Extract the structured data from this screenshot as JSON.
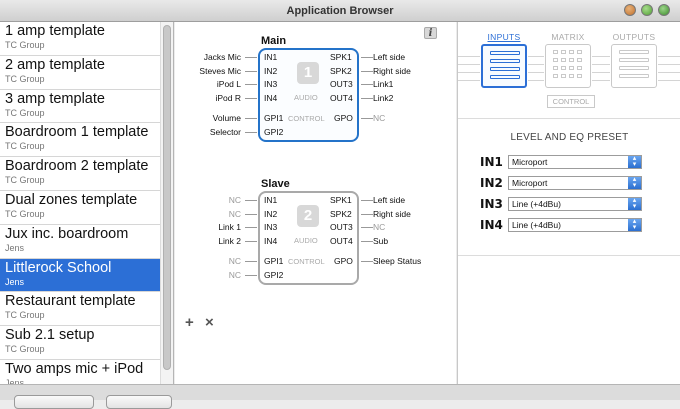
{
  "window": {
    "title": "Application Browser"
  },
  "templates": [
    {
      "name": "1 amp template",
      "author": "TC Group"
    },
    {
      "name": "2 amp template",
      "author": "TC Group"
    },
    {
      "name": "3 amp template",
      "author": "TC Group"
    },
    {
      "name": "Boardroom 1 template",
      "author": "TC Group"
    },
    {
      "name": "Boardroom 2 template",
      "author": "TC Group"
    },
    {
      "name": "Dual zones template",
      "author": "TC Group"
    },
    {
      "name": "Jux inc. boardroom",
      "author": "Jens"
    },
    {
      "name": "Littlerock School",
      "author": "Jens",
      "selected": true
    },
    {
      "name": "Restaurant template",
      "author": "TC Group"
    },
    {
      "name": "Sub 2.1 setup",
      "author": "TC Group"
    },
    {
      "name": "Two amps mic + iPod",
      "author": "Jens"
    }
  ],
  "units": [
    {
      "title": "Main",
      "number": "1",
      "inputs": [
        {
          "port": "IN1",
          "ext": "Jacks Mic"
        },
        {
          "port": "IN2",
          "ext": "Steves Mic"
        },
        {
          "port": "IN3",
          "ext": "iPod L"
        },
        {
          "port": "IN4",
          "ext": "iPod R"
        }
      ],
      "outputs": [
        {
          "port": "SPK1",
          "ext": "Left side"
        },
        {
          "port": "SPK2",
          "ext": "Right side"
        },
        {
          "port": "OUT3",
          "ext": "Link1"
        },
        {
          "port": "OUT4",
          "ext": "Link2"
        }
      ],
      "gpi": [
        {
          "port": "GPI1",
          "ext": "Volume"
        },
        {
          "port": "GPI2",
          "ext": "Selector"
        }
      ],
      "gpo": {
        "port": "GPO",
        "ext": "NC"
      },
      "audio_label": "AUDIO",
      "control_label": "CONTROL"
    },
    {
      "title": "Slave",
      "number": "2",
      "inputs": [
        {
          "port": "IN1",
          "ext": "NC"
        },
        {
          "port": "IN2",
          "ext": "NC"
        },
        {
          "port": "IN3",
          "ext": "Link 1"
        },
        {
          "port": "IN4",
          "ext": "Link 2"
        }
      ],
      "outputs": [
        {
          "port": "SPK1",
          "ext": "Left side"
        },
        {
          "port": "SPK2",
          "ext": "Right side"
        },
        {
          "port": "OUT3",
          "ext": "NC"
        },
        {
          "port": "OUT4",
          "ext": "Sub"
        }
      ],
      "gpi": [
        {
          "port": "GPI1",
          "ext": "NC"
        },
        {
          "port": "GPI2",
          "ext": "NC"
        }
      ],
      "gpo": {
        "port": "GPO",
        "ext": "Sleep Status"
      },
      "audio_label": "AUDIO",
      "control_label": "CONTROL"
    }
  ],
  "actions": {
    "add": "+",
    "remove": "×"
  },
  "tabs": {
    "inputs": "INPUTS",
    "matrix": "MATRIX",
    "outputs": "OUTPUTS",
    "control": "CONTROL",
    "active": "inputs"
  },
  "level_eq": {
    "title": "LEVEL AND EQ PRESET",
    "rows": [
      {
        "label": "IN1",
        "value": "Microport"
      },
      {
        "label": "IN2",
        "value": "Microport"
      },
      {
        "label": "IN3",
        "value": "Line (+4dBu)"
      },
      {
        "label": "IN4",
        "value": "Line (+4dBu)"
      }
    ]
  },
  "colors": {
    "accent": "#2c6fd6",
    "main_box": "#2473c9",
    "slave_box": "#a9a9a9"
  },
  "icons": {
    "info": "info-icon",
    "window_buttons": [
      "minimize-icon",
      "zoom-icon",
      "close-icon"
    ]
  }
}
